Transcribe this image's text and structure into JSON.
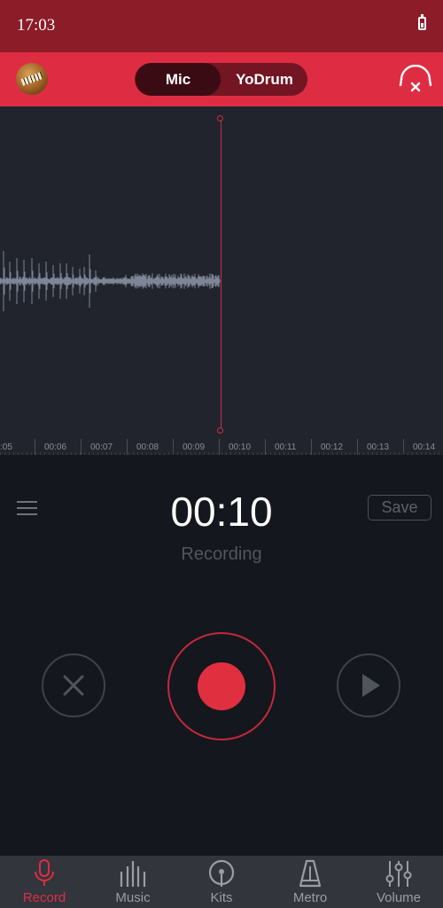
{
  "status_bar": {
    "time": "17:03"
  },
  "header": {
    "modes": [
      "Mic",
      "YoDrum"
    ],
    "active_mode": "Mic"
  },
  "timeline": {
    "ticks": [
      ":05",
      "00:06",
      "00:07",
      "00:08",
      "00:09",
      "00:10",
      "00:11",
      "00:12",
      "00:13",
      "00:14"
    ]
  },
  "recorder": {
    "elapsed": "00:10",
    "state": "Recording",
    "save_label": "Save"
  },
  "nav": {
    "items": [
      {
        "label": "Record",
        "icon": "microphone-icon",
        "active": true
      },
      {
        "label": "Music",
        "icon": "equalizer-bars-icon",
        "active": false
      },
      {
        "label": "Kits",
        "icon": "drumstick-circle-icon",
        "active": false
      },
      {
        "label": "Metro",
        "icon": "metronome-icon",
        "active": false
      },
      {
        "label": "Volume",
        "icon": "mixer-sliders-icon",
        "active": false
      }
    ]
  },
  "colors": {
    "accent": "#de2d42",
    "status_bar": "#8c1c28",
    "waveform": "#7d8596"
  }
}
